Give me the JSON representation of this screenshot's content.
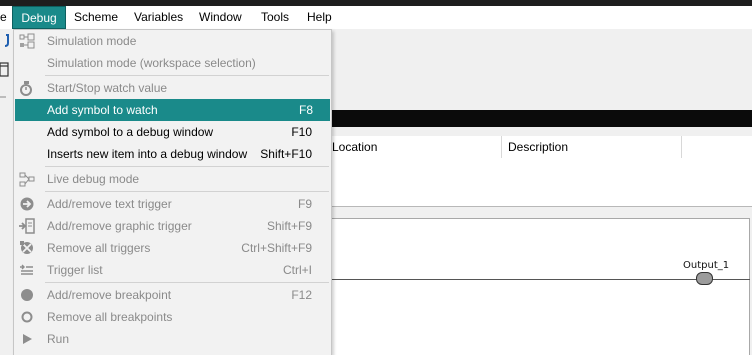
{
  "menubar": {
    "items": [
      {
        "label": "e"
      },
      {
        "label": "Debug"
      },
      {
        "label": "Scheme"
      },
      {
        "label": "Variables"
      },
      {
        "label": "Window"
      },
      {
        "label": "Tools"
      },
      {
        "label": "Help"
      }
    ]
  },
  "debug_menu": {
    "items": [
      {
        "label": "Simulation mode",
        "shortcut": "",
        "icon": "simulation-mode-icon"
      },
      {
        "label": "Simulation mode (workspace selection)",
        "shortcut": ""
      },
      {
        "label": "Start/Stop watch value",
        "shortcut": "",
        "icon": "watch-value-icon"
      },
      {
        "label": "Add symbol to watch",
        "shortcut": "F8"
      },
      {
        "label": "Add symbol to a debug window",
        "shortcut": "F10"
      },
      {
        "label": "Inserts new item into a debug window",
        "shortcut": "Shift+F10"
      },
      {
        "label": "Live debug mode",
        "shortcut": "",
        "icon": "live-debug-icon"
      },
      {
        "label": "Add/remove text trigger",
        "shortcut": "F9",
        "icon": "text-trigger-icon"
      },
      {
        "label": "Add/remove graphic trigger",
        "shortcut": "Shift+F9",
        "icon": "graphic-trigger-icon"
      },
      {
        "label": "Remove all triggers",
        "shortcut": "Ctrl+Shift+F9",
        "icon": "remove-triggers-icon"
      },
      {
        "label": "Trigger list",
        "shortcut": "Ctrl+I",
        "icon": "trigger-list-icon"
      },
      {
        "label": "Add/remove breakpoint",
        "shortcut": "F12",
        "icon": "breakpoint-icon"
      },
      {
        "label": "Remove all breakpoints",
        "shortcut": "",
        "icon": "remove-breakpoints-icon"
      },
      {
        "label": "Run",
        "shortcut": "",
        "icon": "run-icon"
      }
    ]
  },
  "table": {
    "columns": [
      "Location",
      "Description"
    ]
  },
  "diagram": {
    "output_label": "Output_1"
  },
  "colors": {
    "accent": "#1a8a8a",
    "disabled_text": "#8a8a8a",
    "menu_bg": "#f2f2f2"
  }
}
